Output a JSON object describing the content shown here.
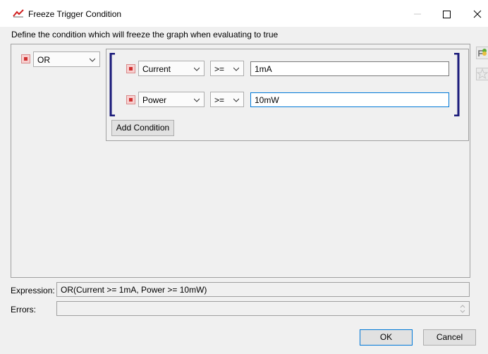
{
  "window": {
    "title": "Freeze Trigger Condition",
    "controls": [
      "minimize-icon",
      "maximize-icon",
      "close-icon"
    ]
  },
  "description": "Define the condition which will freeze the graph when evaluating to true",
  "logic": {
    "operator": "OR"
  },
  "conditions": [
    {
      "signal": "Current",
      "comparator": ">=",
      "value": "1mA"
    },
    {
      "signal": "Power",
      "comparator": ">=",
      "value": "10mW"
    }
  ],
  "add_condition_label": "Add Condition",
  "side_icons": [
    "add-tree-icon",
    "favorite-star-icon"
  ],
  "expression": {
    "label": "Expression:",
    "value": "OR(Current >= 1mA, Power >= 10mW)"
  },
  "errors": {
    "label": "Errors:",
    "value": ""
  },
  "buttons": {
    "ok": "OK",
    "cancel": "Cancel"
  },
  "colors": {
    "bracket": "#1a1a7a",
    "remove": "#d03030",
    "focus": "#0078d7"
  }
}
